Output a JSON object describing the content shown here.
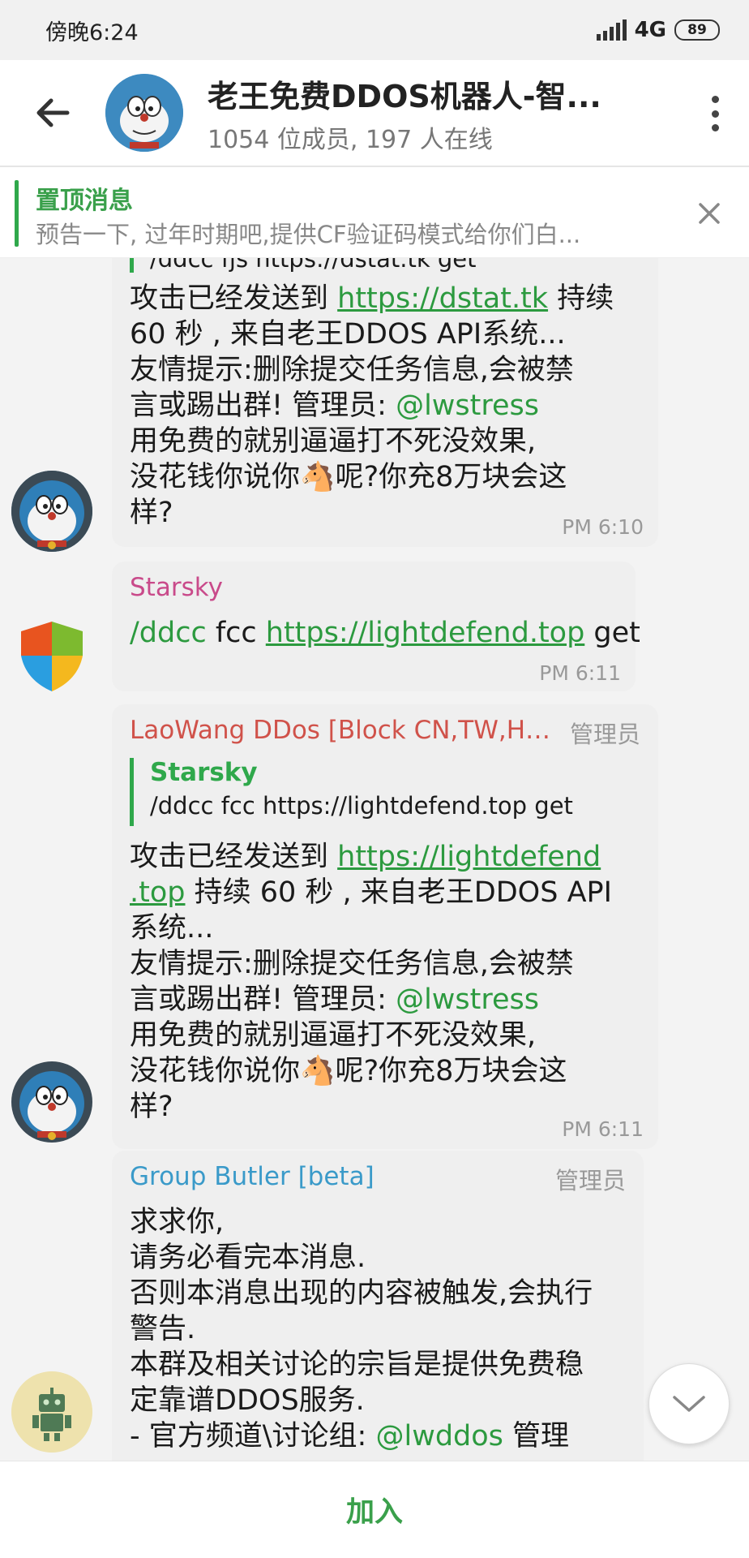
{
  "status_bar": {
    "time": "傍晚6:24",
    "network": "4G",
    "battery": "89"
  },
  "header": {
    "title": "老王免费DDOS机器人-智...",
    "subtitle": "1054 位成员, 197 人在线"
  },
  "pinned": {
    "title": "置顶消息",
    "text": "预告一下, 过年时期吧,提供CF验证码模式给你们白..."
  },
  "messages": [
    {
      "partial_top": "/ddcc fjs https://dstat.tk get",
      "line1_pre": "攻击已经发送到 ",
      "line1_link": "https://dstat.tk",
      "line1_post": " 持续",
      "line2": "60 秒 , 来自老王DDOS API系统...",
      "line3": "友情提示:删除提交任务信息,会被禁",
      "line4_pre": "言或踢出群! 管理员: ",
      "line4_mention": "@lwstress",
      "line5": "用免费的就别逼逼打不死没效果,",
      "line6": "没花钱你说你🐴呢?你充8万块会这",
      "line7": "样?",
      "time": "PM 6:10"
    },
    {
      "sender": "Starsky",
      "cmd": "/ddcc",
      "mid": " fcc ",
      "link": "https://lightdefend.top",
      "post": " get",
      "time": "PM 6:11"
    },
    {
      "sender": "LaoWang DDos [Block CN,TW,HK,...",
      "admin_label": "管理员",
      "quote_name": "Starsky",
      "quote_text": "/ddcc fcc https://lightdefend.top get",
      "line1_pre": "攻击已经发送到 ",
      "line1_link": "https://lightdefend",
      "line2_link": ".top",
      "line2_post": " 持续 60 秒 , 来自老王DDOS API",
      "line3": "系统...",
      "line4": "友情提示:删除提交任务信息,会被禁",
      "line5_pre": "言或踢出群! 管理员: ",
      "line5_mention": "@lwstress",
      "line6": "用免费的就别逼逼打不死没效果,",
      "line7": "没花钱你说你🐴呢?你充8万块会这",
      "line8": "样?",
      "time": "PM 6:11"
    },
    {
      "sender": "Group Butler [beta]",
      "admin_label": "管理员",
      "line1": "求求你,",
      "line2": "请务必看完本消息.",
      "line3": "否则本消息出现的内容被触发,会执行",
      "line4": "警告.",
      "line5": "本群及相关讨论的宗旨是提供免费稳",
      "line6": "定靠谱DDOS服务.",
      "line7_pre": "- 官方频道\\讨论组:  ",
      "line7_mention": "@lwddos",
      "line7_post": " 管理"
    }
  ],
  "join_label": "加入",
  "colors": {
    "accent": "#2c9a3f",
    "sender_pink": "#c94a8a",
    "sender_red": "#d0524a",
    "sender_blue": "#3a9ac9"
  }
}
